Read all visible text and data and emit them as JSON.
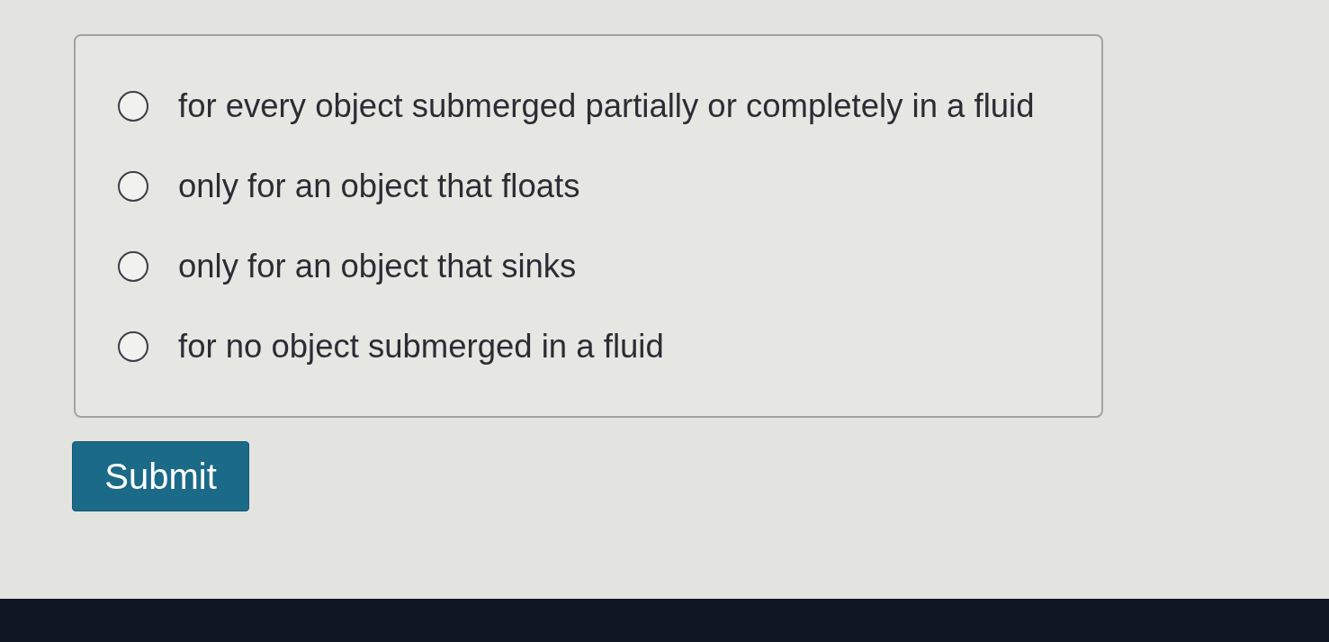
{
  "options": [
    {
      "label": "for every object submerged partially or completely in a fluid",
      "selected": false
    },
    {
      "label": "only for an object that floats",
      "selected": false
    },
    {
      "label": "only for an object that sinks",
      "selected": false
    },
    {
      "label": "for no object submerged in a fluid",
      "selected": false
    }
  ],
  "submit_button": {
    "label": "Submit"
  }
}
